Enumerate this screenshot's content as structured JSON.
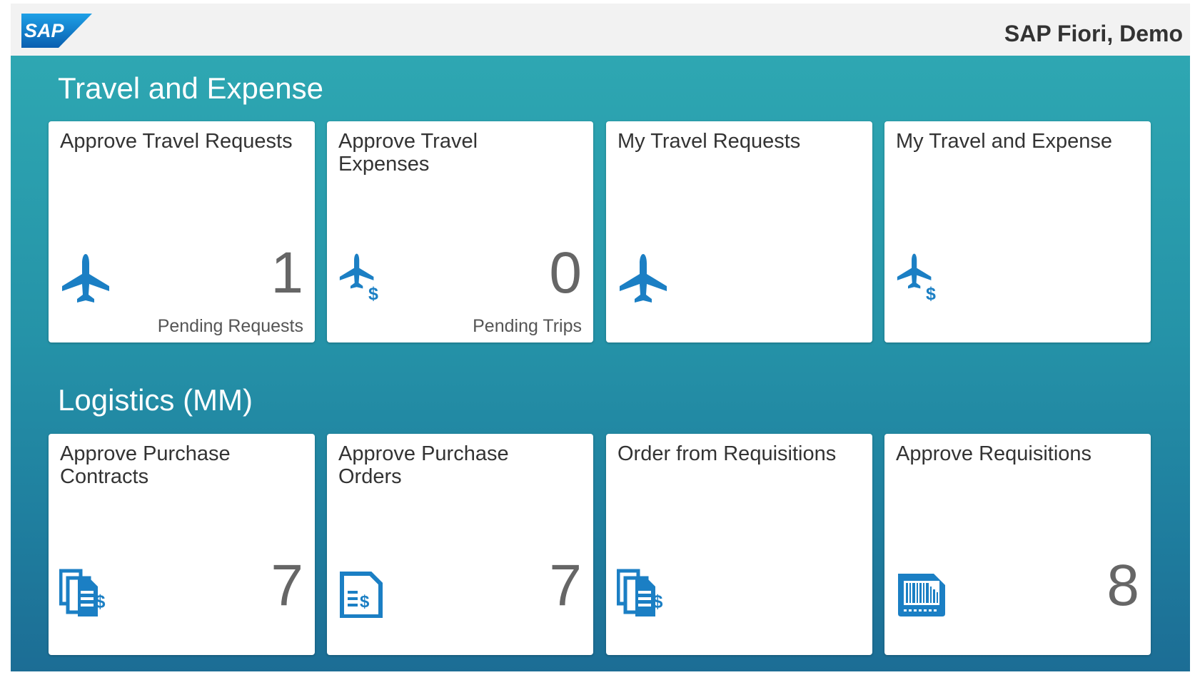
{
  "shell": {
    "logo_text": "SAP",
    "user_label": "SAP Fiori, Demo"
  },
  "colors": {
    "brand_blue": "#0a71bd",
    "icon_blue": "#1b7fc4",
    "background_top": "#2ea7b2",
    "background_bottom": "#1c6d95"
  },
  "groups": [
    {
      "title": "Travel and Expense",
      "tiles": [
        {
          "title": "Approve Travel Requests",
          "icon": "plane-icon",
          "number": "1",
          "info": "Pending Requests"
        },
        {
          "title": "Approve Travel Expenses",
          "icon": "travel-expense-icon",
          "number": "0",
          "info": "Pending Trips"
        },
        {
          "title": "My Travel Requests",
          "icon": "plane-icon",
          "number": "",
          "info": ""
        },
        {
          "title": "My Travel and Expense",
          "icon": "travel-expense-icon",
          "number": "",
          "info": ""
        }
      ]
    },
    {
      "title": "Logistics (MM)",
      "tiles": [
        {
          "title": "Approve Purchase Contracts",
          "icon": "contract-documents-icon",
          "number": "7",
          "info": ""
        },
        {
          "title": "Approve Purchase Orders",
          "icon": "purchase-order-icon",
          "number": "7",
          "info": ""
        },
        {
          "title": "Order from Requisitions",
          "icon": "contract-documents-icon",
          "number": "",
          "info": ""
        },
        {
          "title": "Approve Requisitions",
          "icon": "barcode-icon",
          "number": "8",
          "info": ""
        }
      ]
    }
  ]
}
